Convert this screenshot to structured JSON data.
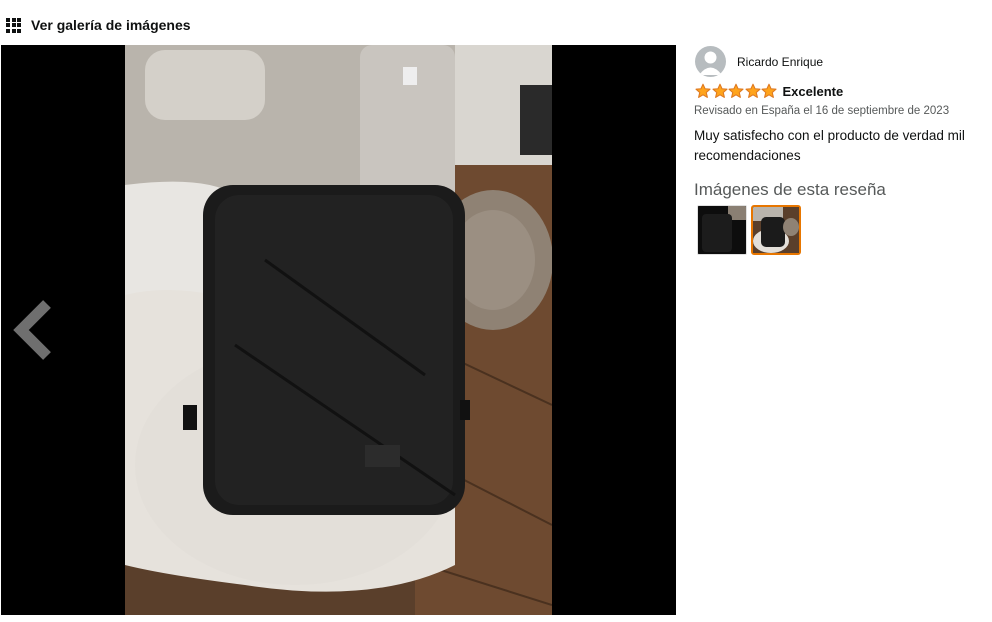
{
  "gallery": {
    "icon": "grid-icon",
    "link_label": "Ver galería de imágenes"
  },
  "viewer": {
    "prev_icon": "chevron-left-icon"
  },
  "review": {
    "reviewer_name": "Ricardo Enrique",
    "rating": 5,
    "rating_max": 5,
    "title": "Excelente",
    "date_line": "Revisado en España el 16 de septiembre de 2023",
    "body": "Muy satisfecho con el producto de verdad mil recomendaciones",
    "images_heading": "Imágenes de esta reseña",
    "thumbnails": [
      {
        "selected": false
      },
      {
        "selected": true
      }
    ]
  },
  "colors": {
    "star": "#ffa41c",
    "star_outline": "#de7921",
    "selected_border": "#e77600",
    "muted_text": "#565959"
  }
}
